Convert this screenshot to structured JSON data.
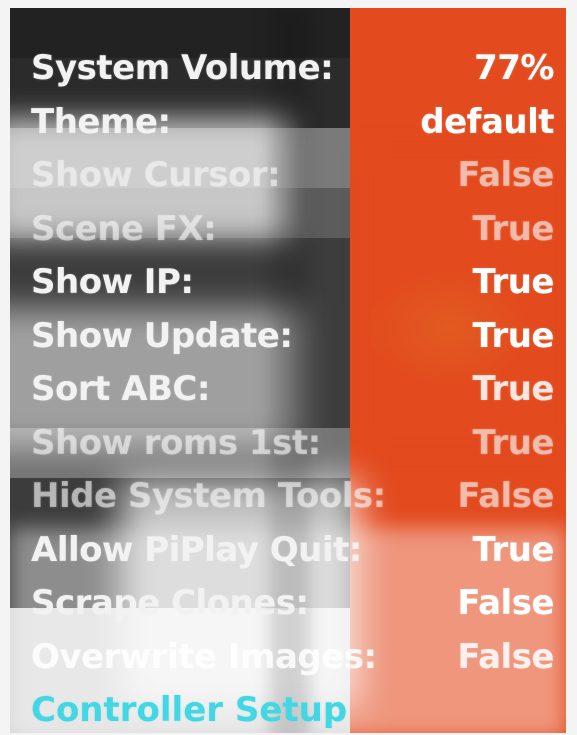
{
  "menu": {
    "items": [
      {
        "label": "System Volume:",
        "value": "77%"
      },
      {
        "label": "Theme:",
        "value": "default"
      },
      {
        "label": "Show Cursor:",
        "value": "False"
      },
      {
        "label": "Scene FX:",
        "value": "True"
      },
      {
        "label": "Show IP:",
        "value": "True"
      },
      {
        "label": "Show Update:",
        "value": "True"
      },
      {
        "label": "Sort ABC:",
        "value": "True"
      },
      {
        "label": "Show roms 1st:",
        "value": "True"
      },
      {
        "label": "Hide System Tools:",
        "value": "False"
      },
      {
        "label": "Allow PiPlay Quit:",
        "value": "True"
      },
      {
        "label": "Scrape Clones:",
        "value": "False"
      },
      {
        "label": "Overwrite Images:",
        "value": "False"
      }
    ],
    "controller_setup": "Controller Setup"
  },
  "colors": {
    "text": "#f2f2f2",
    "accent": "#43d7e4",
    "background_red": "#e34a1e",
    "background_yellow": "#d8d23a"
  }
}
